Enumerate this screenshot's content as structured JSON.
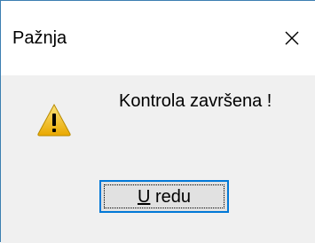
{
  "dialog": {
    "title": "Pažnja",
    "message": "Kontrola završena !",
    "ok_button": {
      "mnemonic": "U",
      "rest": " redu"
    }
  },
  "icons": {
    "close": "close-icon",
    "warning": "warning-icon"
  },
  "colors": {
    "title_background": "#ffffff",
    "body_background": "#f0f0f0",
    "window_border": "#3c7fb1",
    "button_border_focus": "#0078d7",
    "button_face": "#e1e1e1",
    "warning_fill": "#f5c518"
  }
}
